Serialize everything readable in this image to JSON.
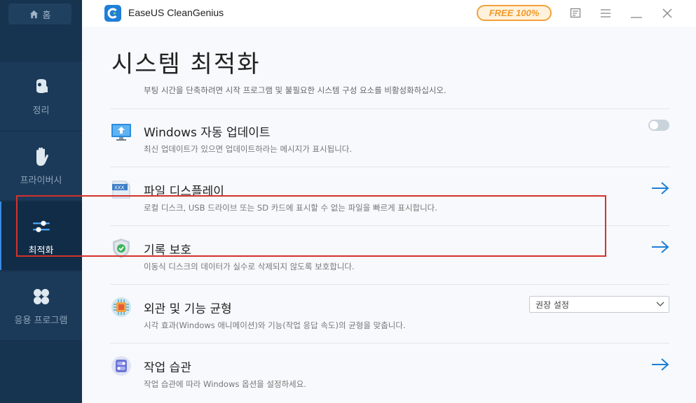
{
  "sidebar": {
    "home_label": "홈",
    "items": [
      {
        "label": "정리",
        "icon": "broom-icon"
      },
      {
        "label": "프라이버시",
        "icon": "hand-icon"
      },
      {
        "label": "최적화",
        "icon": "sliders-icon",
        "active": true
      },
      {
        "label": "응용 프로그램",
        "icon": "apps-icon"
      }
    ]
  },
  "titlebar": {
    "app_name": "EaseUS CleanGenius",
    "badge": "FREE 100%"
  },
  "main": {
    "title": "시스템 최적화",
    "top_desc": "부팅 시간을 단축하려면 시작 프로그램 및 불필요한 시스템 구성 요소를 비활성화하십시오.",
    "rows": [
      {
        "title": "Windows 자동 업데이트",
        "desc": "최신 업데이트가 있으면 업데이트하라는 메시지가 표시됩니다.",
        "control": "toggle",
        "toggle_on": false
      },
      {
        "title": "파일 디스플레이",
        "desc": "로컬 디스크, USB 드라이브 또는 SD 카드에 표시할 수 없는 파일을 빠르게 표시합니다.",
        "control": "arrow"
      },
      {
        "title": "기록 보호",
        "desc": "이동식 디스크의 데이터가 실수로 삭제되지 않도록 보호합니다.",
        "control": "arrow",
        "highlighted": true
      },
      {
        "title": "외관 및 기능 균형",
        "desc": "시각 효과(Windows 애니메이션)와 기능(작업 응답 속도)의 균형을 맞춥니다.",
        "control": "select",
        "select_value": "권장 설정"
      },
      {
        "title": "작업 습관",
        "desc": "작업 습관에 따라 Windows 옵션을 설정하세요.",
        "control": "arrow"
      }
    ]
  },
  "colors": {
    "sidebar_bg": "#16334f",
    "accent": "#1f7fd6",
    "badge": "#f29a2a",
    "highlight": "#d4322c"
  }
}
